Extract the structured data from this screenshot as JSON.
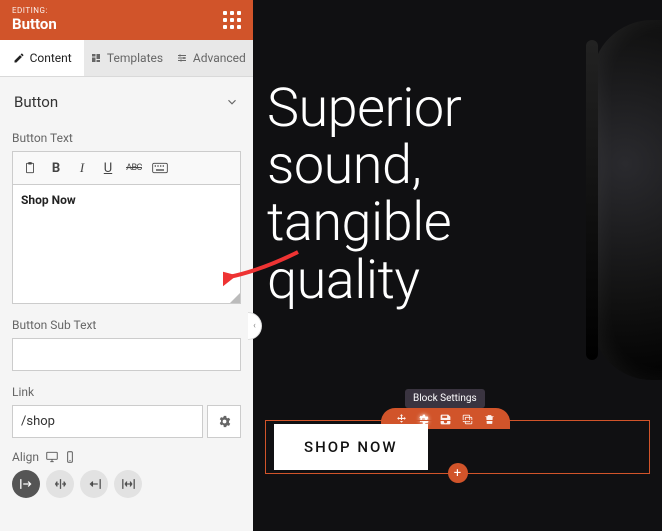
{
  "header": {
    "editing_label": "EDITING:",
    "title": "Button"
  },
  "tabs": {
    "content": "Content",
    "templates": "Templates",
    "advanced": "Advanced"
  },
  "accordion": {
    "title": "Button"
  },
  "fields": {
    "button_text_label": "Button Text",
    "button_text_value": "Shop Now",
    "button_sub_text_label": "Button Sub Text",
    "button_sub_text_value": "",
    "link_label": "Link",
    "link_value": "/shop",
    "align_label": "Align"
  },
  "preview": {
    "hero_line1": "Superior",
    "hero_line2": "sound,",
    "hero_line3": "tangible",
    "hero_line4": "quality",
    "tooltip": "Block Settings",
    "cta": "SHOP NOW"
  }
}
